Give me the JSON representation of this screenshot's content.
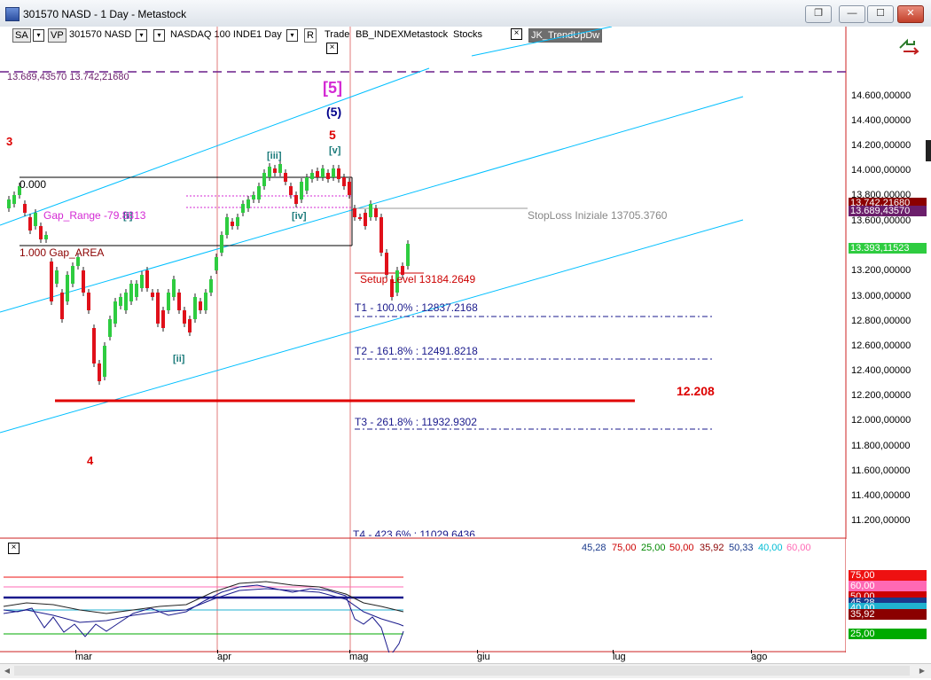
{
  "window": {
    "title": "301570 NASD - 1 Day - Metastock",
    "buttons": [
      "restore-icon",
      "minimize-icon",
      "maximize-icon",
      "close-icon"
    ],
    "close_glyph": "✕",
    "min_glyph": "—",
    "max_glyph": "☐",
    "restore_glyph": "❐"
  },
  "toolbar": {
    "sa": "SA",
    "vp": "VP",
    "symbol": "301570 NASD",
    "index": "NASDAQ 100 INDE",
    "period": "1 Day",
    "r": "R",
    "trade": "Trade",
    "bb": "BB_INDEX",
    "metastock": "Metastock",
    "stocks": "Stocks",
    "expert": "JK_TrendUpDw",
    "close_glyph": "×",
    "dd_glyph": "▾"
  },
  "price_panel": {
    "top_left_values": "13.689,43570  13.742,21680",
    "y_ticks": [
      "14.600,00000",
      "14.400,00000",
      "14.200,00000",
      "14.000,00000",
      "13.800,00000",
      "13.600,00000",
      "13.200,00000",
      "13.000,00000",
      "12.800,00000",
      "12.600,00000",
      "12.400,00000",
      "12.200,00000",
      "12.000,00000",
      "11.800,00000",
      "11.600,00000",
      "11.400,00000",
      "11.200,00000"
    ],
    "tags": [
      {
        "text": "13.742,21680",
        "color": "#8b0000"
      },
      {
        "text": "13.689,43570",
        "color": "#6b1e6b"
      },
      {
        "text": "13.393,11523",
        "color": "#2ecc40"
      }
    ],
    "annotations": {
      "wave5_bracket": "[5]",
      "wave5_paren": "(5)",
      "wave5": "5",
      "wave3": "3",
      "wave4": "4",
      "wave_iii": "[iii]",
      "wave_v": "[v]",
      "wave_iv": "[iv]",
      "wave_ii": "[ii]",
      "wave_i": "[i]",
      "fib_zero": "0.000",
      "gap_range": "Gap_Range -79.8813",
      "gap_area": "1.000  Gap_AREA",
      "stoploss": "StopLoss Iniziale 13705.3760",
      "setup": "Setup Level 13184.2649",
      "t1": "T1 - 100.0% : 12837.2168",
      "t2": "T2 - 161.8% : 12491.8218",
      "t3": "T3 - 261.8% : 11932.9302",
      "t4": "T4 - 423.6% : 11029.6436",
      "support_value": "12.208"
    }
  },
  "indicator_panel": {
    "values": [
      {
        "text": "45,28",
        "color": "#1a3a8c"
      },
      {
        "text": "75,00",
        "color": "#cc0000"
      },
      {
        "text": "25,00",
        "color": "#008800"
      },
      {
        "text": "50,00",
        "color": "#cc0000"
      },
      {
        "text": "35,92",
        "color": "#8b0000"
      },
      {
        "text": "50,33",
        "color": "#1a3a8c"
      },
      {
        "text": "40,00",
        "color": "#00bcd4"
      },
      {
        "text": "60,00",
        "color": "#ff69b4"
      }
    ],
    "tags": [
      {
        "text": "75,00",
        "color": "#ee1111"
      },
      {
        "text": "60,00",
        "color": "#ff69b4"
      },
      {
        "text": "50,00",
        "color": "#cc0000"
      },
      {
        "text": "45,28",
        "color": "#1a3a8c"
      },
      {
        "text": "40,00",
        "color": "#20b2d0"
      },
      {
        "text": "35,92",
        "color": "#8b0000"
      },
      {
        "text": "25,00",
        "color": "#00aa00"
      }
    ]
  },
  "x_axis": {
    "labels": [
      "mar",
      "apr",
      "mag",
      "giu",
      "lug",
      "ago"
    ]
  },
  "colors": {
    "up": "#2ecc40",
    "down": "#e0101a",
    "channel": "#00bfff",
    "wave_blue": "#00008b",
    "wave_red": "#dd0000",
    "magenta": "#d42ad4"
  }
}
